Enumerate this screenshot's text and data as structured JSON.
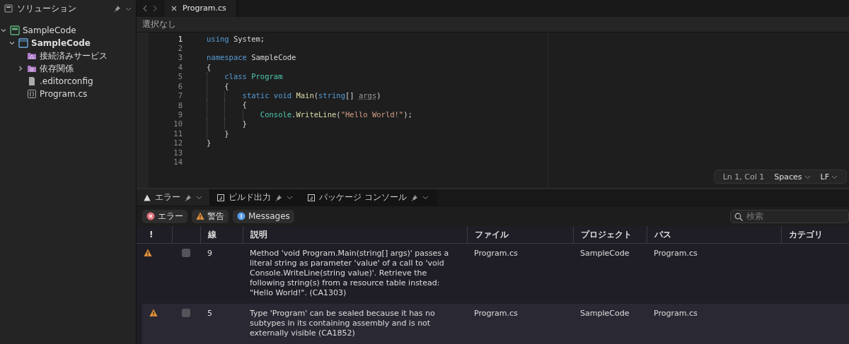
{
  "sidebar": {
    "title": "ソリューション",
    "tree": [
      {
        "label": "SampleCode",
        "kind": "solution",
        "expanded": true,
        "children": [
          {
            "label": "SampleCode",
            "kind": "project",
            "expanded": true,
            "children": [
              {
                "label": "接続済みサービス",
                "kind": "services"
              },
              {
                "label": "依存関係",
                "kind": "dependencies",
                "expanded": false
              },
              {
                "label": ".editorconfig",
                "kind": "file"
              },
              {
                "label": "Program.cs",
                "kind": "code"
              }
            ]
          }
        ]
      }
    ]
  },
  "editor": {
    "tabs": [
      {
        "label": "Program.cs",
        "selected": true
      }
    ],
    "breadcrumb": "選択なし",
    "lines": [
      {
        "number": "1",
        "current": true,
        "tokens": [
          {
            "text": "using",
            "kind": "keyword"
          },
          {
            "text": " System;",
            "kind": "plain"
          }
        ]
      },
      {
        "number": "2",
        "current": false
      },
      {
        "number": "3",
        "current": false,
        "tokens": [
          {
            "text": "namespace",
            "kind": "keyword"
          },
          {
            "text": " SampleCode",
            "kind": "plain"
          }
        ]
      },
      {
        "number": "4",
        "current": false,
        "tokens": [
          {
            "text": "{",
            "kind": "plain"
          }
        ],
        "children": [
          {
            "number": "5",
            "current": false,
            "tokens": [
              {
                "text": "class",
                "kind": "keyword"
              },
              {
                "text": " Program",
                "kind": "type"
              }
            ]
          },
          {
            "number": "6",
            "current": false,
            "tokens": [
              {
                "text": "{",
                "kind": "plain"
              }
            ],
            "children": [
              {
                "number": "7",
                "current": false,
                "tokens": [
                  {
                    "text": "static void",
                    "kind": "keyword"
                  },
                  {
                    "text": " Main",
                    "kind": "method"
                  },
                  {
                    "text": "(",
                    "kind": "plain"
                  },
                  {
                    "text": "string",
                    "kind": "keyword"
                  },
                  {
                    "text": "[] ",
                    "kind": "plain"
                  },
                  {
                    "text": "args",
                    "kind": "unused"
                  },
                  {
                    "text": ")",
                    "kind": "plain"
                  }
                ]
              },
              {
                "number": "8",
                "current": false,
                "tokens": [
                  {
                    "text": "{",
                    "kind": "plain"
                  }
                ],
                "children": [
                  {
                    "number": "9",
                    "current": false,
                    "tokens": [
                      {
                        "text": "Console",
                        "kind": "type"
                      },
                      {
                        "text": ".",
                        "kind": "plain"
                      },
                      {
                        "text": "WriteLine",
                        "kind": "method"
                      },
                      {
                        "text": "(",
                        "kind": "plain"
                      },
                      {
                        "text": "\"Hello World!\"",
                        "kind": "string"
                      },
                      {
                        "text": ");",
                        "kind": "plain"
                      }
                    ]
                  }
                ]
              },
              {
                "number": "10",
                "current": false,
                "tokens": [
                  {
                    "text": "}",
                    "kind": "plain"
                  }
                ]
              }
            ]
          },
          {
            "number": "11",
            "current": false,
            "tokens": [
              {
                "text": "}",
                "kind": "plain"
              }
            ]
          }
        ]
      },
      {
        "number": "12",
        "current": false,
        "tokens": [
          {
            "text": "}",
            "kind": "plain"
          }
        ]
      },
      {
        "number": "13",
        "current": false
      },
      {
        "number": "14",
        "current": false
      }
    ],
    "status": {
      "position": "Ln 1, Col 1",
      "indent": "Spaces",
      "line_ending": "LF"
    }
  },
  "panel": {
    "tabs": [
      {
        "label": "エラー",
        "kind": "errors",
        "selected": true
      },
      {
        "label": "ビルド出力",
        "kind": "output",
        "selected": false
      },
      {
        "label": "パッケージ コンソール",
        "kind": "output",
        "selected": false
      }
    ],
    "filters": [
      {
        "label": "エラー",
        "kind": "error"
      },
      {
        "label": "警告",
        "kind": "warning"
      },
      {
        "label": "Messages",
        "kind": "info"
      }
    ],
    "search": {
      "placeholder": "検索"
    },
    "table": {
      "columns": [
        {
          "label": "!"
        },
        {
          "kind": "checkbox"
        },
        {
          "label": "線"
        },
        {
          "label": "説明"
        },
        {
          "label": "ファイル"
        },
        {
          "label": "プロジェクト"
        },
        {
          "label": "パス"
        },
        {
          "label": "カテゴリ"
        }
      ],
      "rows": [
        {
          "kind": "warning",
          "checked": false,
          "selected": false,
          "line": "9",
          "description": "Method 'void Program.Main(string[] args)' passes a literal string as parameter 'value' of a call to 'void Console.WriteLine(string value)'. Retrieve the following string(s) from a resource table instead: \"Hello World!\". (CA1303)",
          "file": "Program.cs",
          "project": "SampleCode",
          "path": "Program.cs"
        },
        {
          "kind": "warning",
          "checked": false,
          "selected": true,
          "line": "5",
          "description": "Type 'Program' can be sealed because it has no subtypes in its containing assembly and is not externally visible (CA1852)",
          "file": "Program.cs",
          "project": "SampleCode",
          "path": "Program.cs"
        }
      ]
    }
  }
}
